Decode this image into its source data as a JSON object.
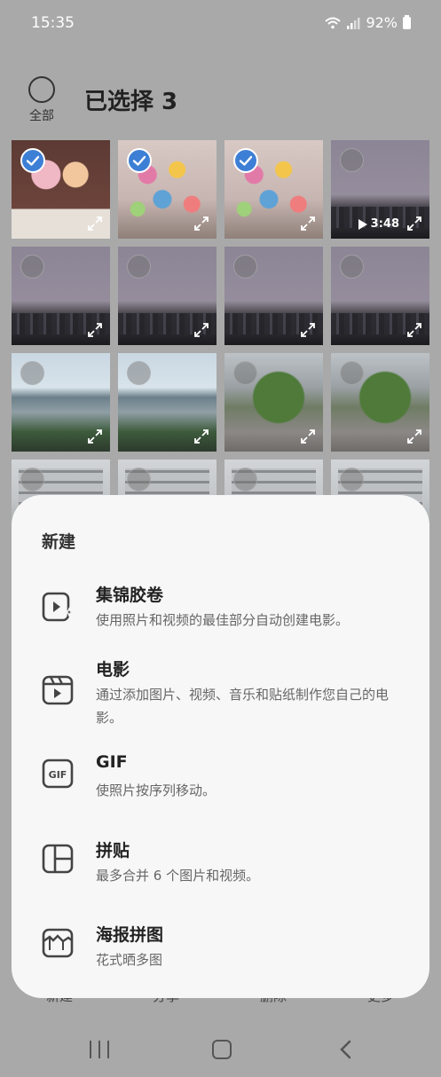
{
  "status_bar": {
    "time": "15:35",
    "battery": "92%",
    "icons": [
      "wifi-icon",
      "signal-icon",
      "battery-icon"
    ]
  },
  "header": {
    "select_all_label": "全部",
    "title": "已选择 3"
  },
  "grid": {
    "items": [
      {
        "kind": "photo",
        "selected": true,
        "scene": "desk"
      },
      {
        "kind": "photo",
        "selected": true,
        "scene": "stickers"
      },
      {
        "kind": "photo",
        "selected": true,
        "scene": "stickers"
      },
      {
        "kind": "video",
        "selected": false,
        "scene": "city-dusk",
        "duration": "3:48"
      },
      {
        "kind": "photo",
        "selected": false,
        "scene": "city-dusk"
      },
      {
        "kind": "photo",
        "selected": false,
        "scene": "city-dusk"
      },
      {
        "kind": "photo",
        "selected": false,
        "scene": "city-dusk"
      },
      {
        "kind": "photo",
        "selected": false,
        "scene": "city-dusk"
      },
      {
        "kind": "photo",
        "selected": false,
        "scene": "river"
      },
      {
        "kind": "photo",
        "selected": false,
        "scene": "river"
      },
      {
        "kind": "photo",
        "selected": false,
        "scene": "terrace"
      },
      {
        "kind": "photo",
        "selected": false,
        "scene": "terrace"
      },
      {
        "kind": "photo",
        "selected": false,
        "scene": "building"
      },
      {
        "kind": "photo",
        "selected": false,
        "scene": "building"
      },
      {
        "kind": "photo",
        "selected": false,
        "scene": "building"
      },
      {
        "kind": "photo",
        "selected": false,
        "scene": "building"
      }
    ]
  },
  "bottom_actions": {
    "create": "新建",
    "share": "分享",
    "delete": "删除",
    "more": "更多"
  },
  "sheet": {
    "title": "新建",
    "options": [
      {
        "icon": "highlight-reel-icon",
        "title": "集锦胶卷",
        "desc": "使用照片和视频的最佳部分自动创建电影。"
      },
      {
        "icon": "movie-clapper-icon",
        "title": "电影",
        "desc": "通过添加图片、视频、音乐和贴纸制作您自己的电影。"
      },
      {
        "icon": "gif-icon",
        "title": "GIF",
        "desc": "使照片按序列移动。"
      },
      {
        "icon": "collage-icon",
        "title": "拼贴",
        "desc": "最多合并 6 个图片和视频。"
      },
      {
        "icon": "poster-collage-icon",
        "title": "海报拼图",
        "desc": "花式晒多图"
      }
    ]
  },
  "colors": {
    "accent": "#3e7fd6",
    "dim_overlay": "#a9a9a9",
    "sheet_bg": "#f7f7f7"
  }
}
